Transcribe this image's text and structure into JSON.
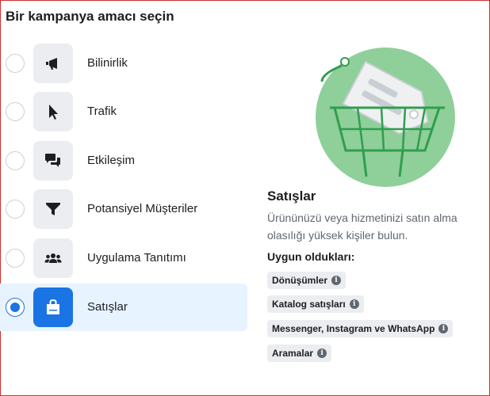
{
  "heading": "Bir kampanya amacı seçin",
  "objectives": [
    {
      "label": "Bilinirlik",
      "icon": "megaphone-icon",
      "selected": false
    },
    {
      "label": "Trafik",
      "icon": "cursor-icon",
      "selected": false
    },
    {
      "label": "Etkileşim",
      "icon": "chat-bubbles-icon",
      "selected": false
    },
    {
      "label": "Potansiyel Müşteriler",
      "icon": "filter-icon",
      "selected": false
    },
    {
      "label": "Uygulama Tanıtımı",
      "icon": "people-icon",
      "selected": false
    },
    {
      "label": "Satışlar",
      "icon": "shopping-bag-icon",
      "selected": true
    }
  ],
  "detail": {
    "title": "Satışlar",
    "description": "Ürününüzü veya hizmetinizi satın alma olasılığı yüksek kişiler bulun.",
    "good_for_label": "Uygun oldukları:",
    "good_for": [
      "Dönüşümler",
      "Katalog satışları",
      "Messenger, Instagram ve WhatsApp",
      "Aramalar"
    ],
    "info_glyph": "i"
  },
  "colors": {
    "accent": "#1b74e4",
    "selected_bg": "#e7f3ff",
    "illustration_bg": "#8fcf9a",
    "illustration_dark": "#2f9e4e"
  }
}
